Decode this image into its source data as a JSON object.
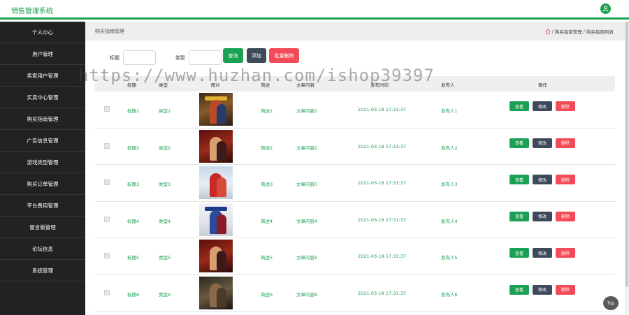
{
  "app": {
    "title": "销售管理系统",
    "user_icon": "user-icon"
  },
  "sidebar": {
    "items": [
      {
        "label": "个人中心"
      },
      {
        "label": "用户管理"
      },
      {
        "label": "卖家用户管理"
      },
      {
        "label": "买卖中心管理"
      },
      {
        "label": "购买指南管理"
      },
      {
        "label": "广告信息管理"
      },
      {
        "label": "游戏类型管理"
      },
      {
        "label": "购买订单管理"
      },
      {
        "label": "平台费用管理"
      },
      {
        "label": "留言板管理"
      },
      {
        "label": "论坛信息"
      },
      {
        "label": "系统管理"
      }
    ]
  },
  "breadcrumb": {
    "title": "购买指南管理",
    "sep": "/",
    "level1": "购买指南管理",
    "level2": "购买指南列表",
    "home_icon": "home-icon"
  },
  "search": {
    "title_label": "标题",
    "title_value": "",
    "type_label": "类型",
    "type_value": "",
    "query_button": "查询",
    "add_button": "添加",
    "batch_delete_button": "批量删除"
  },
  "table": {
    "headers": [
      "标题",
      "类型",
      "图片",
      "简述",
      "文章内容",
      "发布时间",
      "发布人",
      "操作"
    ],
    "action_labels": {
      "view": "查看",
      "edit": "修改",
      "delete": "删除"
    },
    "rows": [
      {
        "title": "标题1",
        "type": "类型1",
        "summary": "简述1",
        "content": "文章内容1",
        "time": "2021-03-18 17:31:37",
        "author": "发布人1"
      },
      {
        "title": "标题2",
        "type": "类型2",
        "summary": "简述2",
        "content": "文章内容2",
        "time": "2021-03-18 17:31:37",
        "author": "发布人2"
      },
      {
        "title": "标题3",
        "type": "类型3",
        "summary": "简述3",
        "content": "文章内容3",
        "time": "2021-03-18 17:31:37",
        "author": "发布人3"
      },
      {
        "title": "标题4",
        "type": "类型4",
        "summary": "简述4",
        "content": "文章内容4",
        "time": "2021-03-18 17:31:37",
        "author": "发布人4"
      },
      {
        "title": "标题5",
        "type": "类型5",
        "summary": "简述5",
        "content": "文章内容5",
        "time": "2021-03-18 17:31:37",
        "author": "发布人5"
      },
      {
        "title": "标题6",
        "type": "类型6",
        "summary": "简述6",
        "content": "文章内容6",
        "time": "2021-03-18 17:31:37",
        "author": "发布人6"
      }
    ]
  },
  "watermark": "https://www.huzhan.com/ishop39397",
  "top_button": "Top",
  "colors": {
    "accent": "#1ba153",
    "sidebar": "#222222",
    "danger": "#f24a56",
    "dark": "#3e4a5a"
  }
}
